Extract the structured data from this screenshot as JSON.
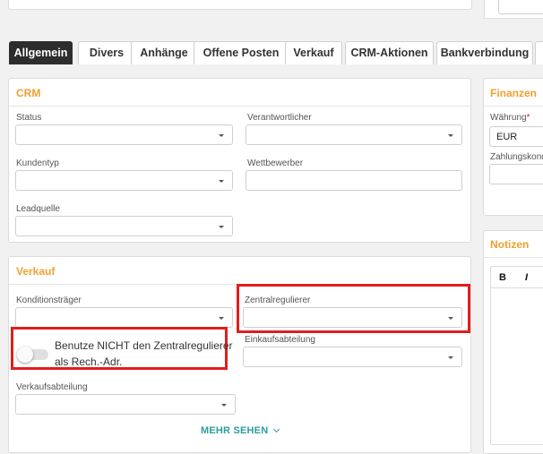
{
  "tabs": [
    {
      "label": "Allgemein",
      "active": true
    },
    {
      "label": "Divers"
    },
    {
      "label": "Anhänge"
    },
    {
      "label": "Offene Posten"
    },
    {
      "label": "Verkauf"
    },
    {
      "label": "CRM-Aktionen"
    },
    {
      "label": "Bankverbindung"
    }
  ],
  "crm": {
    "title": "CRM",
    "status_label": "Status",
    "verantwortlicher_label": "Verantwortlicher",
    "kundentyp_label": "Kundentyp",
    "wettbewerber_label": "Wettbewerber",
    "leadquelle_label": "Leadquelle"
  },
  "verkauf": {
    "title": "Verkauf",
    "konditionstraeger_label": "Konditionsträger",
    "zentralregulierer_label": "Zentralregulierer",
    "toggle_text_1": "Benutze NICHT den Zentralregulierer",
    "toggle_text_2": "als Rech.-Adr.",
    "toggle_on": false,
    "einkaufsabteilung_label": "Einkaufsabteilung",
    "verkaufsabteilung_label": "Verkaufsabteilung",
    "more_label": "MEHR SEHEN"
  },
  "finanzen": {
    "title": "Finanzen",
    "waehrung_label": "Währung",
    "required_mark": "*",
    "waehrung_value": "EUR",
    "zahlungskond_label": "Zahlungskond"
  },
  "notizen": {
    "title": "Notizen",
    "bold_btn": "B",
    "italic_btn": "I"
  },
  "colors": {
    "accent_orange": "#f0a030",
    "highlight_red": "#e01e1e",
    "link_teal": "#2a9d9d",
    "tab_active_bg": "#2d2d2d"
  }
}
